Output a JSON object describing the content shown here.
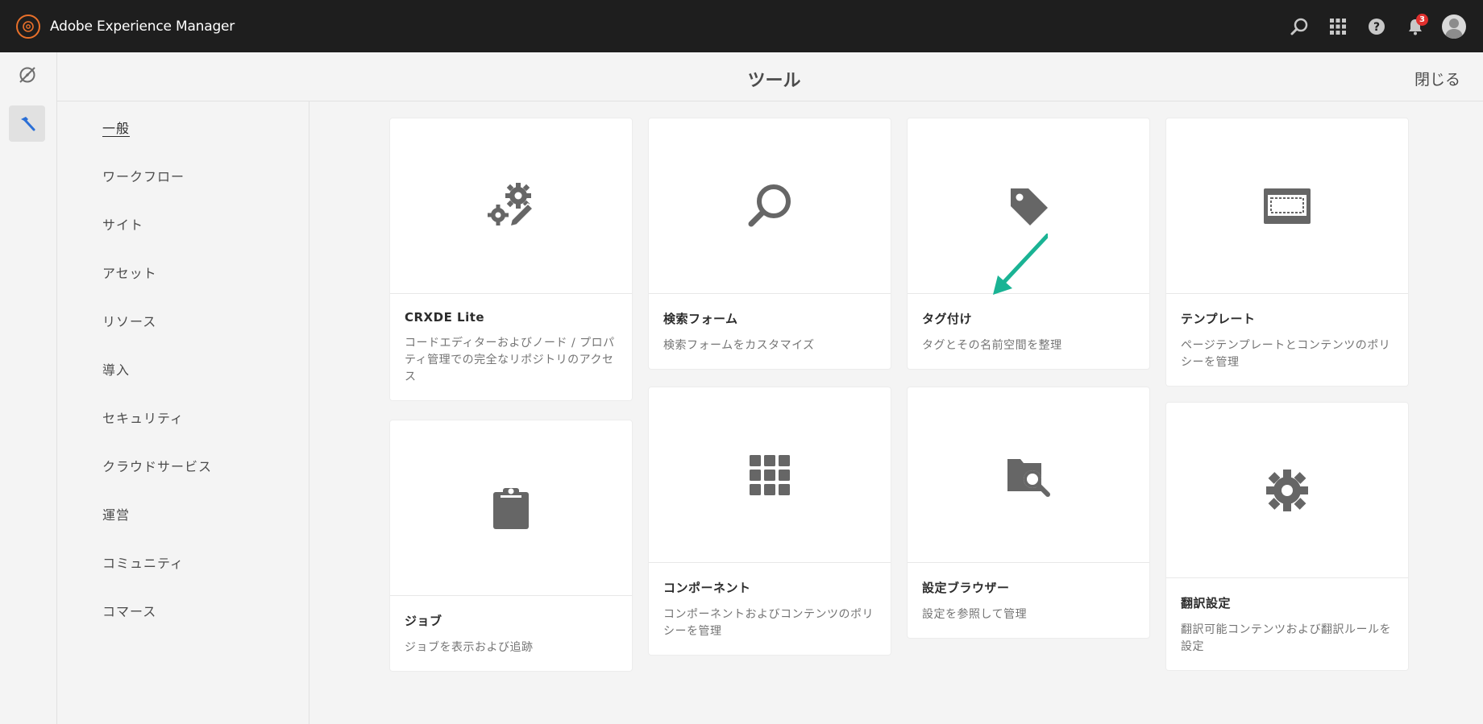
{
  "app": {
    "title": "Adobe Experience Manager",
    "notification_count": "3",
    "brand_color": "#e8702a",
    "accent_arrow_color": "#1ab394"
  },
  "topbar": {
    "icons": [
      "search-icon",
      "apps-grid-icon",
      "help-icon",
      "bell-icon",
      "user-avatar"
    ]
  },
  "rail": {
    "items": [
      "navigation-icon",
      "hammer-icon"
    ]
  },
  "header": {
    "title": "ツール",
    "close_label": "閉じる"
  },
  "categories": [
    {
      "label": "一般",
      "active": true
    },
    {
      "label": "ワークフロー"
    },
    {
      "label": "サイト"
    },
    {
      "label": "アセット"
    },
    {
      "label": "リソース"
    },
    {
      "label": "導入"
    },
    {
      "label": "セキュリティ"
    },
    {
      "label": "クラウドサービス"
    },
    {
      "label": "運営"
    },
    {
      "label": "コミュニティ"
    },
    {
      "label": "コマース"
    }
  ],
  "cards": [
    {
      "title": "CRXDE Lite",
      "desc": "コードエディターおよびノード / プロパティ管理での完全なリポジトリのアクセス",
      "icon": "gears-pencil-icon"
    },
    {
      "title": "ジョブ",
      "desc": "ジョブを表示および追跡",
      "icon": "clipboard-icon"
    },
    {
      "title": "検索フォーム",
      "desc": "検索フォームをカスタマイズ",
      "icon": "magnifier-icon"
    },
    {
      "title": "コンポーネント",
      "desc": "コンポーネントおよびコンテンツのポリシーを管理",
      "icon": "grid-icon"
    },
    {
      "title": "タグ付け",
      "desc": "タグとその名前空間を整理",
      "icon": "tag-icon"
    },
    {
      "title": "設定ブラウザー",
      "desc": "設定を参照して管理",
      "icon": "folder-search-icon"
    },
    {
      "title": "テンプレート",
      "desc": "ページテンプレートとコンテンツのポリシーを管理",
      "icon": "template-icon"
    },
    {
      "title": "翻訳設定",
      "desc": "翻訳可能コンテンツおよび翻訳ルールを設定",
      "icon": "gear-icon"
    }
  ]
}
